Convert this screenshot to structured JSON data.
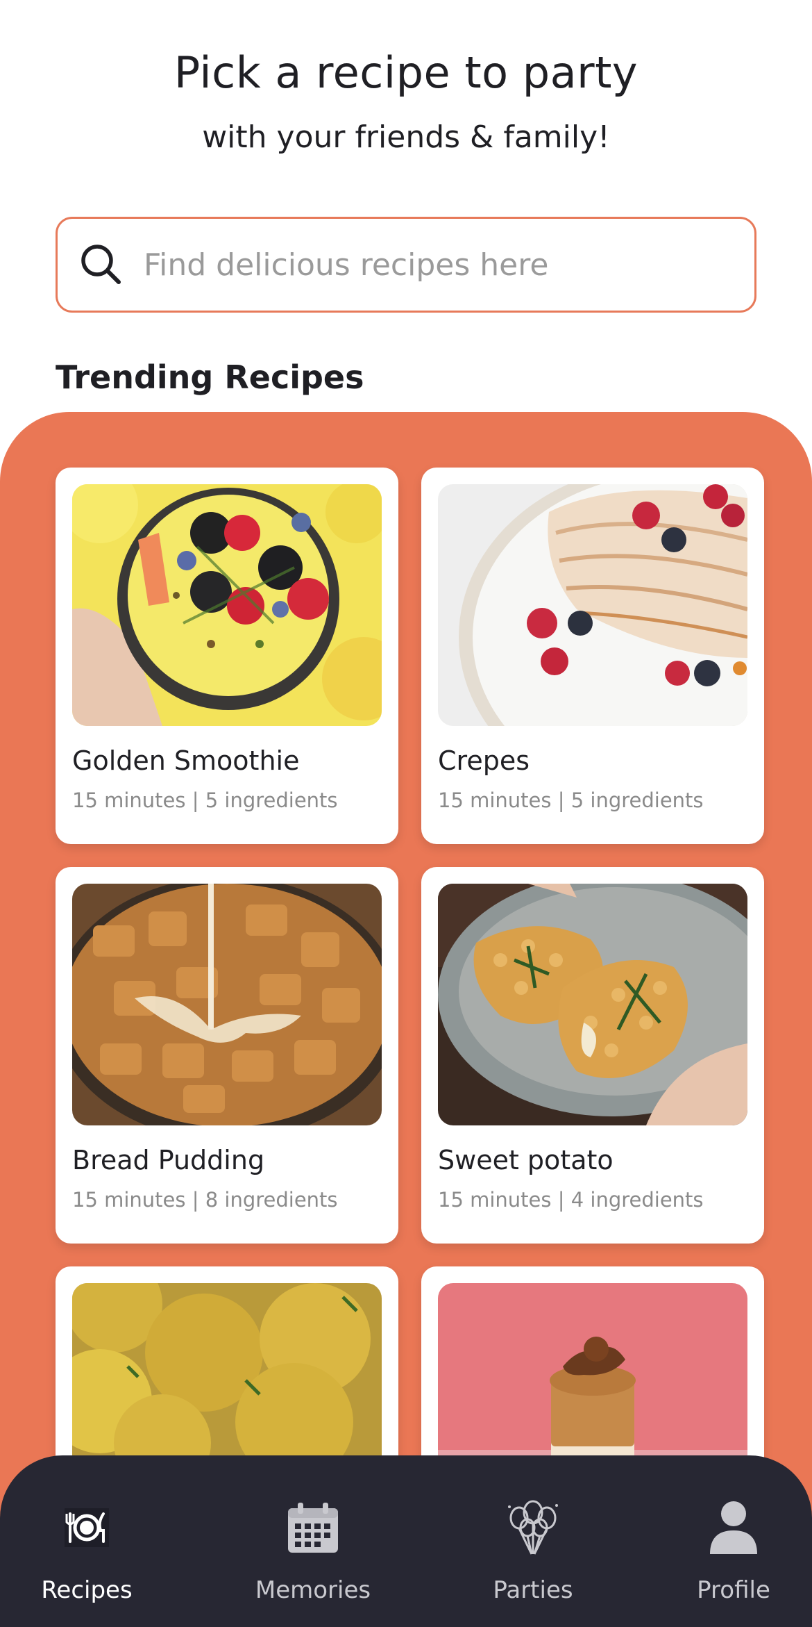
{
  "header": {
    "title": "Pick a recipe to party",
    "subtitle": "with your friends & family!"
  },
  "search": {
    "placeholder": "Find delicious recipes here",
    "icon": "search-icon"
  },
  "section": {
    "title": "Trending Recipes"
  },
  "recipes": [
    {
      "name": "Golden Smoothie",
      "meta": "15 minutes | 5 ingredients"
    },
    {
      "name": "Crepes",
      "meta": "15 minutes | 5 ingredients"
    },
    {
      "name": "Bread Pudding",
      "meta": "15 minutes | 8 ingredients"
    },
    {
      "name": "Sweet potato",
      "meta": "15 minutes | 4 ingredients"
    },
    {
      "name": "",
      "meta": ""
    },
    {
      "name": "",
      "meta": ""
    }
  ],
  "nav": {
    "items": [
      {
        "label": "Recipes",
        "icon": "plate-cutlery-icon",
        "active": true
      },
      {
        "label": "Memories",
        "icon": "calendar-icon",
        "active": false
      },
      {
        "label": "Parties",
        "icon": "balloons-icon",
        "active": false
      },
      {
        "label": "Profile",
        "icon": "person-icon",
        "active": false
      }
    ]
  },
  "colors": {
    "accent": "#ea7755",
    "search_border": "#e77a5a",
    "nav_background": "#272733",
    "text": "#1f1f24",
    "muted": "#8a8a8a"
  }
}
